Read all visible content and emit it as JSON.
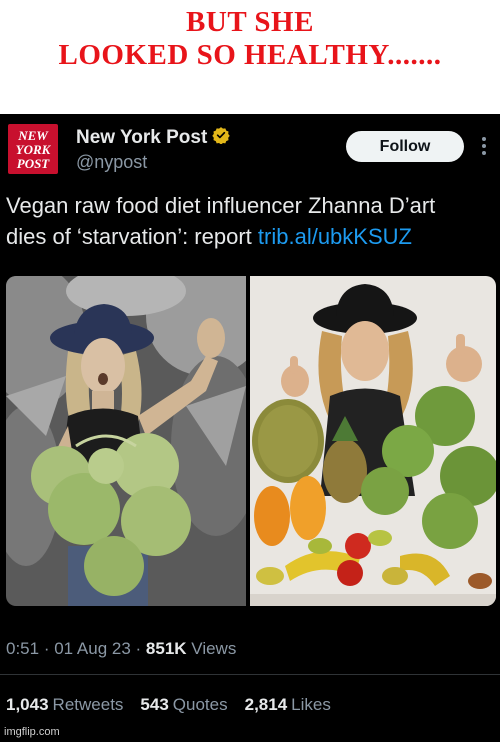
{
  "caption": {
    "line1": "BUT SHE",
    "line2": "LOOKED SO HEALTHY......."
  },
  "tweet": {
    "account": {
      "name": "New York Post",
      "handle": "@nypost",
      "verified_color": "#e2b719",
      "logo_lines": [
        "NEW",
        "YORK",
        "POST"
      ],
      "logo_color": "#c8102e"
    },
    "follow_label": "Follow",
    "text_line1": "Vegan raw food diet influencer Zhanna D’art",
    "text_line2": "dies of ‘starvation’: report ",
    "link": "trib.al/ubkKSUZ",
    "time": "0:51",
    "date": "01 Aug 23",
    "views_count": "851K",
    "views_label": "Views",
    "retweets_count": "1,043",
    "retweets_label": "Retweets",
    "quotes_count": "543",
    "quotes_label": "Quotes",
    "likes_count": "2,814",
    "likes_label": "Likes"
  },
  "watermark": "imgflip.com",
  "colors": {
    "caption_red": "#e8141a",
    "tweet_bg": "#000000",
    "link_blue": "#1d9bf0",
    "muted_text": "#8b98a5"
  }
}
